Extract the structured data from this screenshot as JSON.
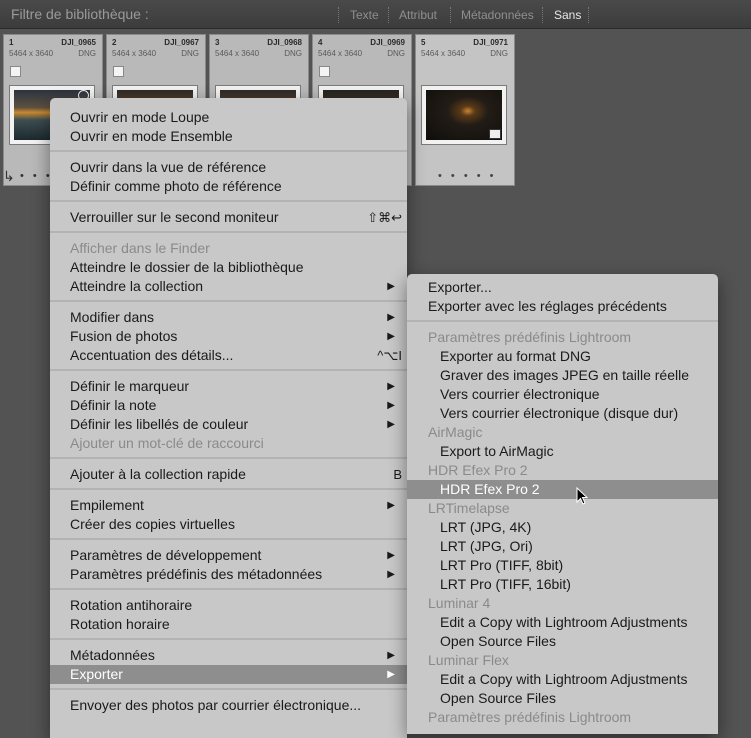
{
  "filter_bar": {
    "title": "Filtre de bibliothèque :",
    "tabs": [
      "Texte",
      "Attribut",
      "Métadonnées",
      "Sans"
    ],
    "active_tab": "Sans"
  },
  "grid": {
    "cells": [
      {
        "index": "1",
        "name": "DJI_0965",
        "dims": "5464 x 3640",
        "format": "DNG"
      },
      {
        "index": "2",
        "name": "DJI_0967",
        "dims": "5464 x 3640",
        "format": "DNG"
      },
      {
        "index": "3",
        "name": "DJI_0968",
        "dims": "5464 x 3640",
        "format": "DNG"
      },
      {
        "index": "4",
        "name": "DJI_0969",
        "dims": "5464 x 3640",
        "format": "DNG"
      },
      {
        "index": "5",
        "name": "DJI_0971",
        "dims": "5464 x 3640",
        "format": "DNG"
      }
    ],
    "dots": "• • • • •"
  },
  "context_menu": {
    "items": [
      {
        "label": "Ouvrir en mode Loupe"
      },
      {
        "label": "Ouvrir en mode Ensemble"
      },
      {
        "label": "Ouvrir dans la vue de référence"
      },
      {
        "label": "Définir comme photo de référence"
      },
      {
        "label": "Verrouiller sur le second moniteur",
        "shortcut": "⇧⌘↩"
      },
      {
        "label": "Afficher dans le Finder",
        "disabled": true
      },
      {
        "label": "Atteindre le dossier de la bibliothèque"
      },
      {
        "label": "Atteindre la collection",
        "submenu": true
      },
      {
        "label": "Modifier dans",
        "submenu": true
      },
      {
        "label": "Fusion de photos",
        "submenu": true
      },
      {
        "label": "Accentuation des détails...",
        "shortcut": "^⌥I"
      },
      {
        "label": "Définir le marqueur",
        "submenu": true
      },
      {
        "label": "Définir la note",
        "submenu": true
      },
      {
        "label": "Définir les libellés de couleur",
        "submenu": true
      },
      {
        "label": "Ajouter un mot-clé de raccourci",
        "disabled": true
      },
      {
        "label": "Ajouter à la collection rapide",
        "shortcut": "B"
      },
      {
        "label": "Empilement",
        "submenu": true
      },
      {
        "label": "Créer des copies virtuelles"
      },
      {
        "label": "Paramètres de développement",
        "submenu": true
      },
      {
        "label": "Paramètres prédéfinis des métadonnées",
        "submenu": true
      },
      {
        "label": "Rotation antihoraire"
      },
      {
        "label": "Rotation horaire"
      },
      {
        "label": "Métadonnées",
        "submenu": true
      },
      {
        "label": "Exporter",
        "submenu": true,
        "highlighted": true
      },
      {
        "label": "Envoyer des photos par courrier électronique..."
      }
    ]
  },
  "export_submenu": {
    "items": [
      {
        "label": "Exporter..."
      },
      {
        "label": "Exporter avec les réglages précédents"
      },
      {
        "label": "Paramètres prédéfinis Lightroom",
        "header": true
      },
      {
        "label": "Exporter au format DNG"
      },
      {
        "label": "Graver des images JPEG en taille réelle"
      },
      {
        "label": "Vers courrier électronique"
      },
      {
        "label": "Vers courrier électronique (disque dur)"
      },
      {
        "label": "AirMagic",
        "header": true
      },
      {
        "label": "Export to AirMagic"
      },
      {
        "label": "HDR Efex Pro 2",
        "header": true
      },
      {
        "label": "HDR Efex Pro 2",
        "highlighted": true
      },
      {
        "label": "LRTimelapse",
        "header": true
      },
      {
        "label": "LRT (JPG, 4K)"
      },
      {
        "label": "LRT (JPG, Ori)"
      },
      {
        "label": "LRT Pro (TIFF, 8bit)"
      },
      {
        "label": "LRT Pro (TIFF, 16bit)"
      },
      {
        "label": "Luminar 4",
        "header": true
      },
      {
        "label": "Edit a Copy with Lightroom Adjustments"
      },
      {
        "label": "Open Source Files"
      },
      {
        "label": "Luminar Flex",
        "header": true
      },
      {
        "label": "Edit a Copy with Lightroom Adjustments"
      },
      {
        "label": "Open Source Files"
      },
      {
        "label": "Paramètres prédéfinis Lightroom",
        "header": true
      }
    ]
  }
}
